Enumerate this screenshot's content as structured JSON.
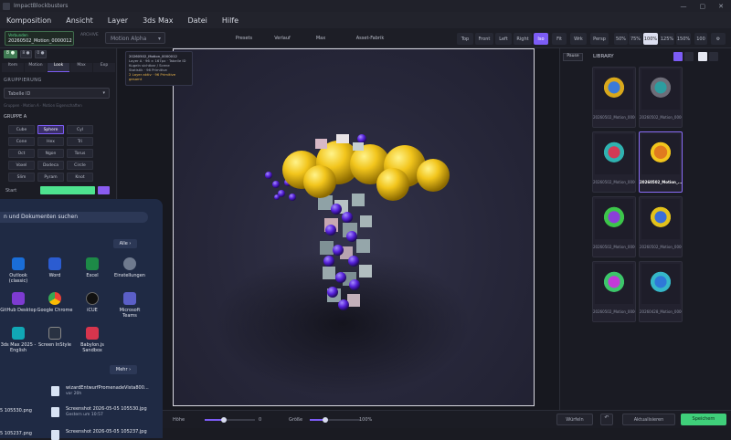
{
  "window": {
    "title": "ImpactBlockbusters",
    "controls": [
      "—",
      "▢",
      "✕"
    ]
  },
  "menu": [
    "Komposition",
    "Ansicht",
    "Layer",
    "3ds Max",
    "Datei",
    "Hilfe"
  ],
  "toolbar": {
    "status": "Verbunden",
    "file_name": "20260502_Motion_0000012",
    "fps_a": "8 ●",
    "fps_b": "0 ●",
    "archive_label": "ARCHIVE",
    "preset_name": "Motion Alpha",
    "center_tabs": [
      "Presets",
      "Verlauf",
      "Max",
      "Asset-Fabrik"
    ],
    "view_buttons": [
      "Top",
      "Front",
      "Left",
      "Right",
      "Iso",
      "Fit",
      "Wrk",
      "Persp"
    ],
    "zoom_buttons": [
      "50%",
      "75%",
      "100%",
      "125%",
      "150%"
    ],
    "zoom_extra": "100"
  },
  "left_panel": {
    "tabs": [
      "Item",
      "Motion",
      "Look",
      "Max",
      "Exp"
    ],
    "active_tab": "Look",
    "section_group": "GRUPPIERUNG",
    "group_select": "Tabelle ID",
    "breadcrumb": "Gruppen · Motion A · Motion Eigenschaften",
    "group_a": "GRUPPE A",
    "shapes": [
      "Cube",
      "Sphere",
      "Cyl",
      "Cone",
      "Hex",
      "Tri",
      "Oct",
      "Ngon",
      "Torus",
      "Voxel",
      "Dodeca",
      "Circle",
      "Slim",
      "Pyram",
      "Knot"
    ],
    "active_shape": "Sphere",
    "start_label": "Start",
    "color_a": "#4ee38f",
    "color_b": "#8a5cf0"
  },
  "overlay": {
    "title": "20260502_Motion_0000012",
    "line1": "Layer A · 96 × 167px · Tabelle ID",
    "line2": "Kugeln sichtbar / Scene",
    "line3": "Statistik · 96 Primitive",
    "warn": "2 Layer aktiv · 96 Primitive gesamt"
  },
  "right_panel": {
    "pause": "Pause",
    "library": "LIBRARY",
    "items": [
      {
        "label": "20260502_Motion_0000..."
      },
      {
        "label": "20260502_Motion_0000..."
      },
      {
        "label": "20260502_Motion_0000..."
      },
      {
        "label": "20260502_Motion_..."
      },
      {
        "label": "20260502_Motion_0000..."
      },
      {
        "label": "20260502_Motion_0000..."
      },
      {
        "label": "20260502_Motion_0000..."
      },
      {
        "label": "20260428_Motion_0000..."
      }
    ]
  },
  "bottom_bar": {
    "height_label": "Höhe",
    "height_value": "0",
    "size_label": "Größe",
    "size_value": "100%",
    "btn_cube": "Würfeln",
    "btn_refresh": "Aktualisieren",
    "btn_save": "Speichern"
  },
  "start_menu": {
    "search_placeholder": "n und Dokumenten suchen",
    "all_button": "Alle",
    "apps": [
      {
        "name": "Outlook (classic)"
      },
      {
        "name": "Word"
      },
      {
        "name": "Excel"
      },
      {
        "name": "Einstellungen"
      },
      {
        "name": "GitHub Desktop"
      },
      {
        "name": "Google Chrome"
      },
      {
        "name": "iCUE"
      },
      {
        "name": "Microsoft Teams"
      },
      {
        "name": "3ds Max 2025 - English"
      },
      {
        "name": "Screen InStyle"
      },
      {
        "name": "Babylon.js Sandbox"
      }
    ],
    "more_button": "Mehr",
    "recent": [
      {
        "name": "wizardEntwurfPromenadeVista800...",
        "time": "vor 20h"
      },
      {
        "name": "Screenshot 2026-05-05 105530.jpg",
        "time": "Gestern um 10:57"
      },
      {
        "name": "Screenshot 2026-05-05 105237.jpg",
        "time": ""
      }
    ],
    "side_file_1": "5 105530.png",
    "side_file_2": "5 105237.png"
  },
  "accent": "#7c5cf5",
  "save_color": "#3fcf7a"
}
